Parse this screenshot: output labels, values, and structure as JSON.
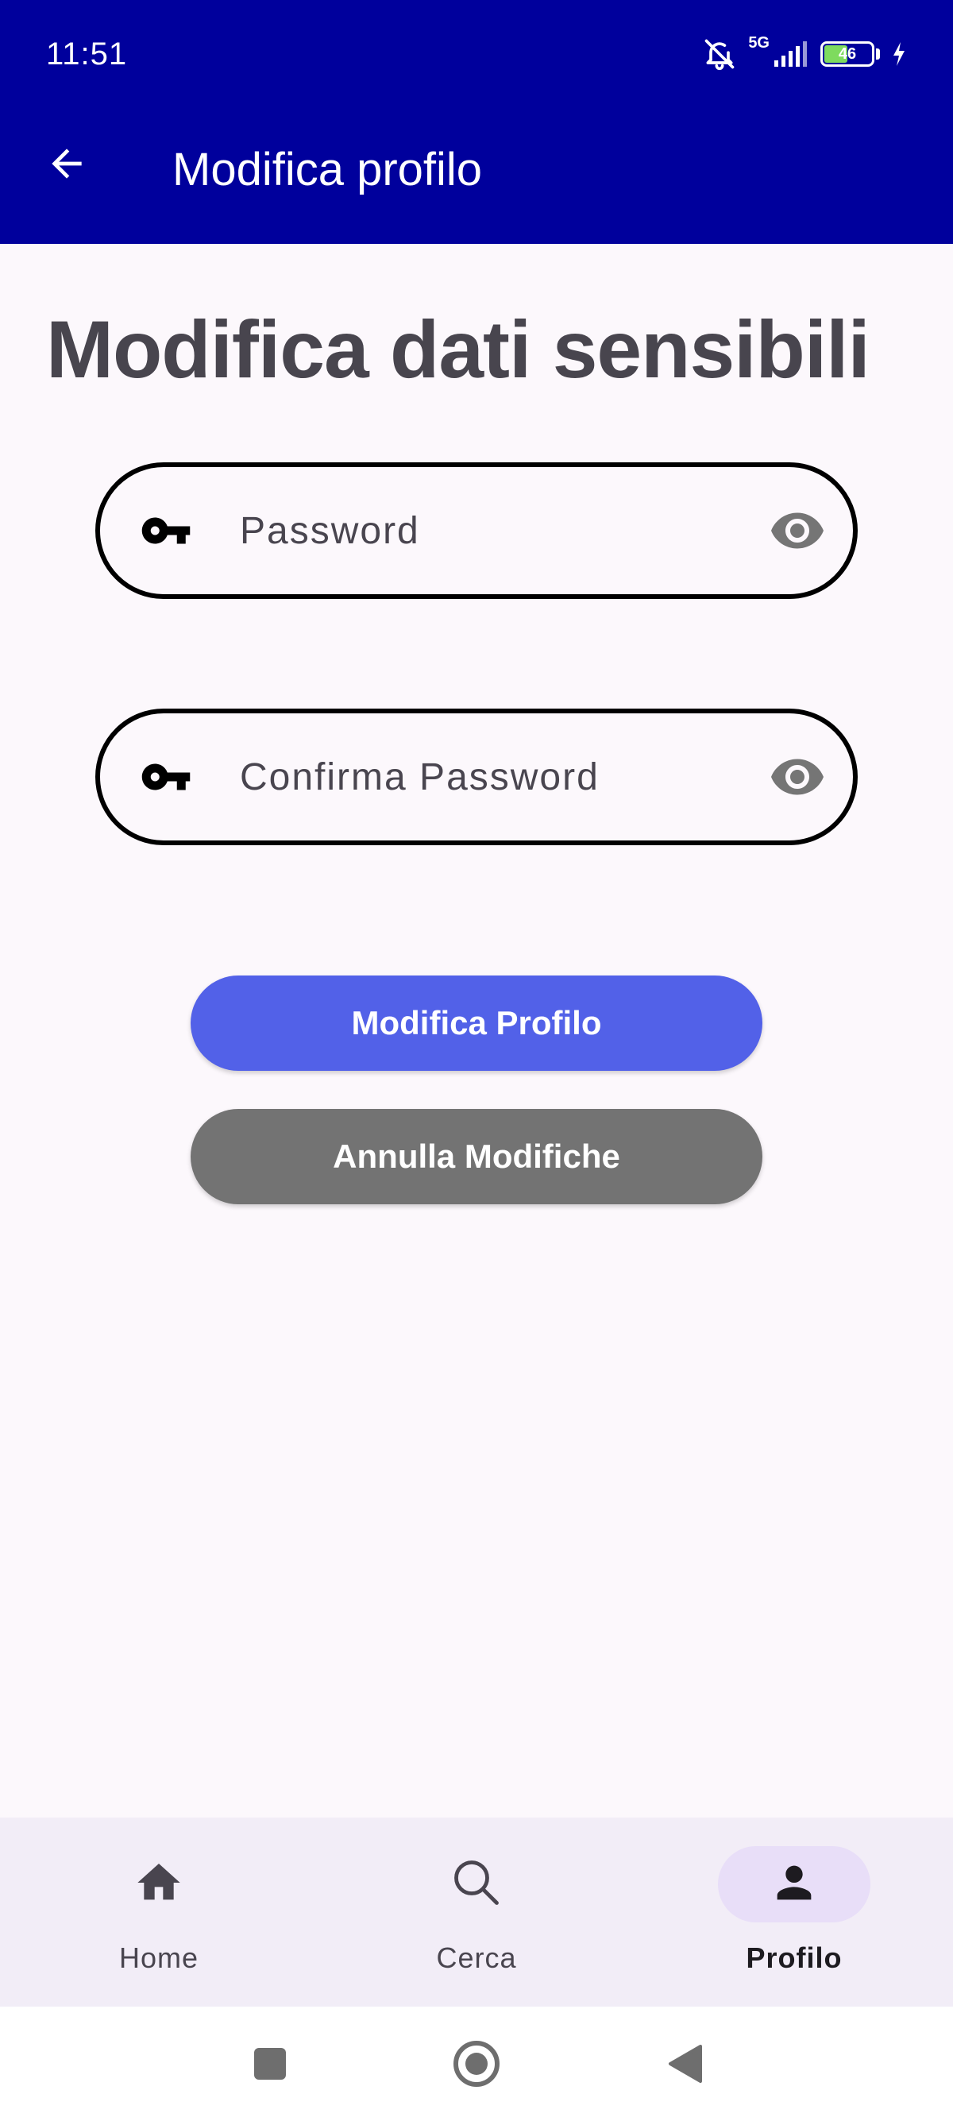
{
  "status_bar": {
    "time": "11:51",
    "network": "5G",
    "battery_level": "46",
    "icons": [
      "bell-off-icon",
      "signal-icon",
      "battery-icon",
      "charging-icon"
    ]
  },
  "app_bar": {
    "title": "Modifica profilo",
    "back_icon": "arrow-back-icon",
    "background_color": "#00009C"
  },
  "main": {
    "heading": "Modifica dati sensibili",
    "password_field": {
      "placeholder": "Password",
      "value": "",
      "leading_icon": "key-icon",
      "trailing_icon": "eye-icon"
    },
    "confirm_password_field": {
      "placeholder": "Confirma Password",
      "value": "",
      "leading_icon": "key-icon",
      "trailing_icon": "eye-icon"
    },
    "primary_button": {
      "label": "Modifica Profilo",
      "color": "#5261E8"
    },
    "secondary_button": {
      "label": "Annulla Modifiche",
      "color": "#737373"
    }
  },
  "bottom_nav": {
    "items": [
      {
        "label": "Home",
        "icon": "home-icon",
        "active": false
      },
      {
        "label": "Cerca",
        "icon": "search-icon",
        "active": false
      },
      {
        "label": "Profilo",
        "icon": "person-icon",
        "active": true
      }
    ],
    "active_pill_color": "#E8DEF8"
  },
  "system_nav": {
    "buttons": [
      "recents-icon",
      "home-circle-icon",
      "back-triangle-icon"
    ]
  }
}
